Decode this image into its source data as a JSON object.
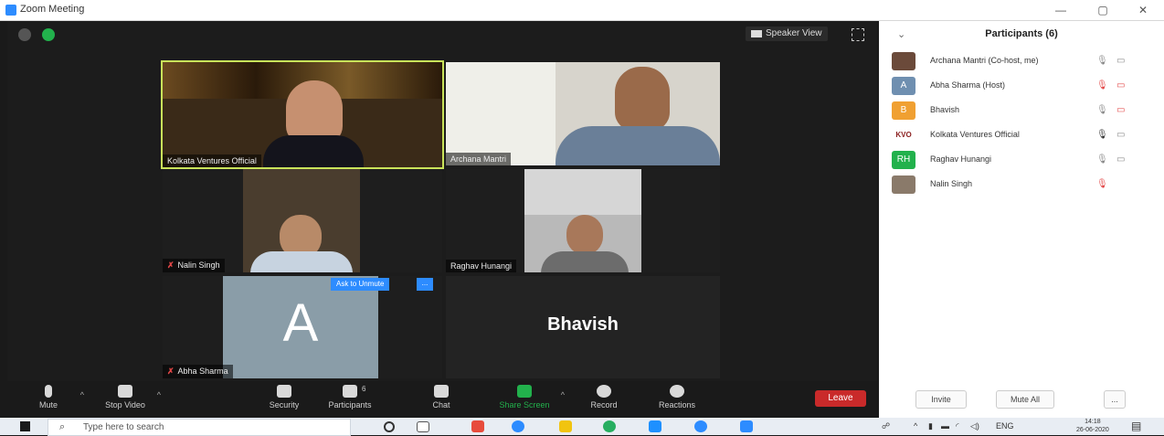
{
  "window": {
    "title": "Zoom Meeting",
    "minimize": "—",
    "maximize": "▢",
    "close": "✕"
  },
  "meeting": {
    "view_mode": "Speaker View",
    "tiles": [
      {
        "name": "Kolkata Ventures Official",
        "muted": false,
        "active_speaker": true,
        "colors": {
          "bg": "#3a2a18"
        }
      },
      {
        "name": "Archana Mantri",
        "muted": false,
        "active_speaker": false,
        "colors": {
          "bg": "#cfcfcf"
        }
      },
      {
        "name": "Nalin Singh",
        "muted": true,
        "active_speaker": false,
        "colors": {
          "bg": "#4a3d2e"
        }
      },
      {
        "name": "Raghav Hunangi",
        "muted": false,
        "active_speaker": false,
        "colors": {
          "bg": "#bdbdbd"
        }
      },
      {
        "name": "Abha Sharma",
        "muted": true,
        "active_speaker": false,
        "avatar_letter": "A",
        "colors": {
          "bg": "#8a9da8"
        }
      },
      {
        "name": "Bhavish",
        "muted": false,
        "active_speaker": false,
        "display": "Bhavish"
      }
    ],
    "ask_to_unmute": "Ask to Unmute",
    "ask_more": "...",
    "mic_off_icon": "✗"
  },
  "toolbar": {
    "mute": "Mute",
    "stop_video": "Stop Video",
    "security": "Security",
    "participants": "Participants",
    "participants_count": "6",
    "chat": "Chat",
    "share_screen": "Share Screen",
    "record": "Record",
    "reactions": "Reactions",
    "leave": "Leave",
    "caret": "^"
  },
  "participants_panel": {
    "title": "Participants (6)",
    "collapse": "⌄",
    "items": [
      {
        "name": "Archana Mantri (Co-host, me)",
        "avatar": "",
        "avatar_color": "#6b4a3a",
        "mic": "🎙",
        "cam": "▭",
        "mic_muted": false,
        "cam_off": false
      },
      {
        "name": "Abha Sharma (Host)",
        "avatar": "A",
        "avatar_color": "#6f8fb0",
        "mic": "🎙",
        "cam": "▭",
        "mic_muted": true,
        "cam_off": true
      },
      {
        "name": "Bhavish",
        "avatar": "B",
        "avatar_color": "#f0a032",
        "mic": "🎙",
        "cam": "▭",
        "mic_muted": false,
        "cam_off": true
      },
      {
        "name": "Kolkata Ventures Official",
        "avatar": "KVO",
        "avatar_color": "#ffffff",
        "mic": "🎙",
        "cam": "▭",
        "mic_muted": false,
        "cam_off": false
      },
      {
        "name": "Raghav Hunangi",
        "avatar": "RH",
        "avatar_color": "#22b14c",
        "mic": "🎙",
        "cam": "▭",
        "mic_muted": false,
        "cam_off": false
      },
      {
        "name": "Nalin Singh",
        "avatar": "",
        "avatar_color": "#8a7a6a",
        "mic": "🎙",
        "cam": "▭",
        "mic_muted": true,
        "cam_off": false
      }
    ],
    "invite": "Invite",
    "mute_all": "Mute All",
    "more": "..."
  },
  "taskbar": {
    "search_placeholder": "Type here to search",
    "search_icon": "⌕",
    "language": "ENG",
    "time": "14:18",
    "date": "26-06-2020",
    "app_colors": [
      "#e74c3c",
      "#2d8cff",
      "#f1c40f",
      "#27ae60",
      "#1e90ff",
      "#2d8cff",
      "#2d8cff"
    ]
  }
}
